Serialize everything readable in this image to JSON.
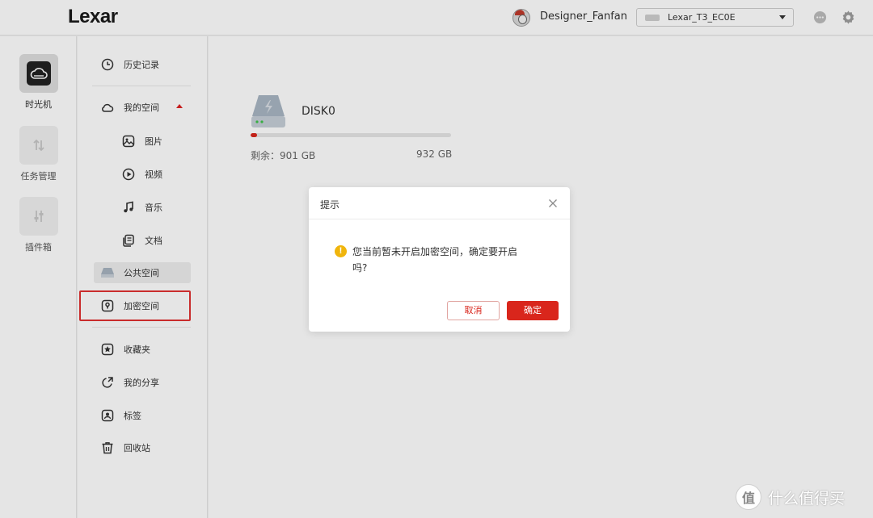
{
  "header": {
    "logo": "Lexar",
    "username": "Designer_Fanfan",
    "device": "Lexar_T3_EC0E"
  },
  "rail": {
    "items": [
      {
        "label": "时光机",
        "icon": "cloud-icon",
        "active": true
      },
      {
        "label": "任务管理",
        "icon": "transfer-arrows-icon",
        "active": false
      },
      {
        "label": "插件箱",
        "icon": "sliders-icon",
        "active": false
      }
    ]
  },
  "nav": {
    "history": "历史记录",
    "my_space": "我的空间",
    "photos": "图片",
    "videos": "视频",
    "music": "音乐",
    "documents": "文档",
    "public_space": "公共空间",
    "encrypted_space": "加密空间",
    "favorites": "收藏夹",
    "my_shares": "我的分享",
    "tags": "标签",
    "recycle_bin": "回收站"
  },
  "disk": {
    "name": "DISK0",
    "free_label": "剩余：901 GB",
    "total": "932 GB",
    "used_fraction": 0.033
  },
  "dialog": {
    "title": "提示",
    "message": "您当前暂未开启加密空间，确定要开启吗?",
    "cancel": "取消",
    "confirm": "确定"
  },
  "watermark": {
    "symbol": "值",
    "text": "什么值得买"
  },
  "colors": {
    "accent": "#d9261c",
    "warning": "#f0b50c",
    "highlight_box": "#e03131"
  }
}
